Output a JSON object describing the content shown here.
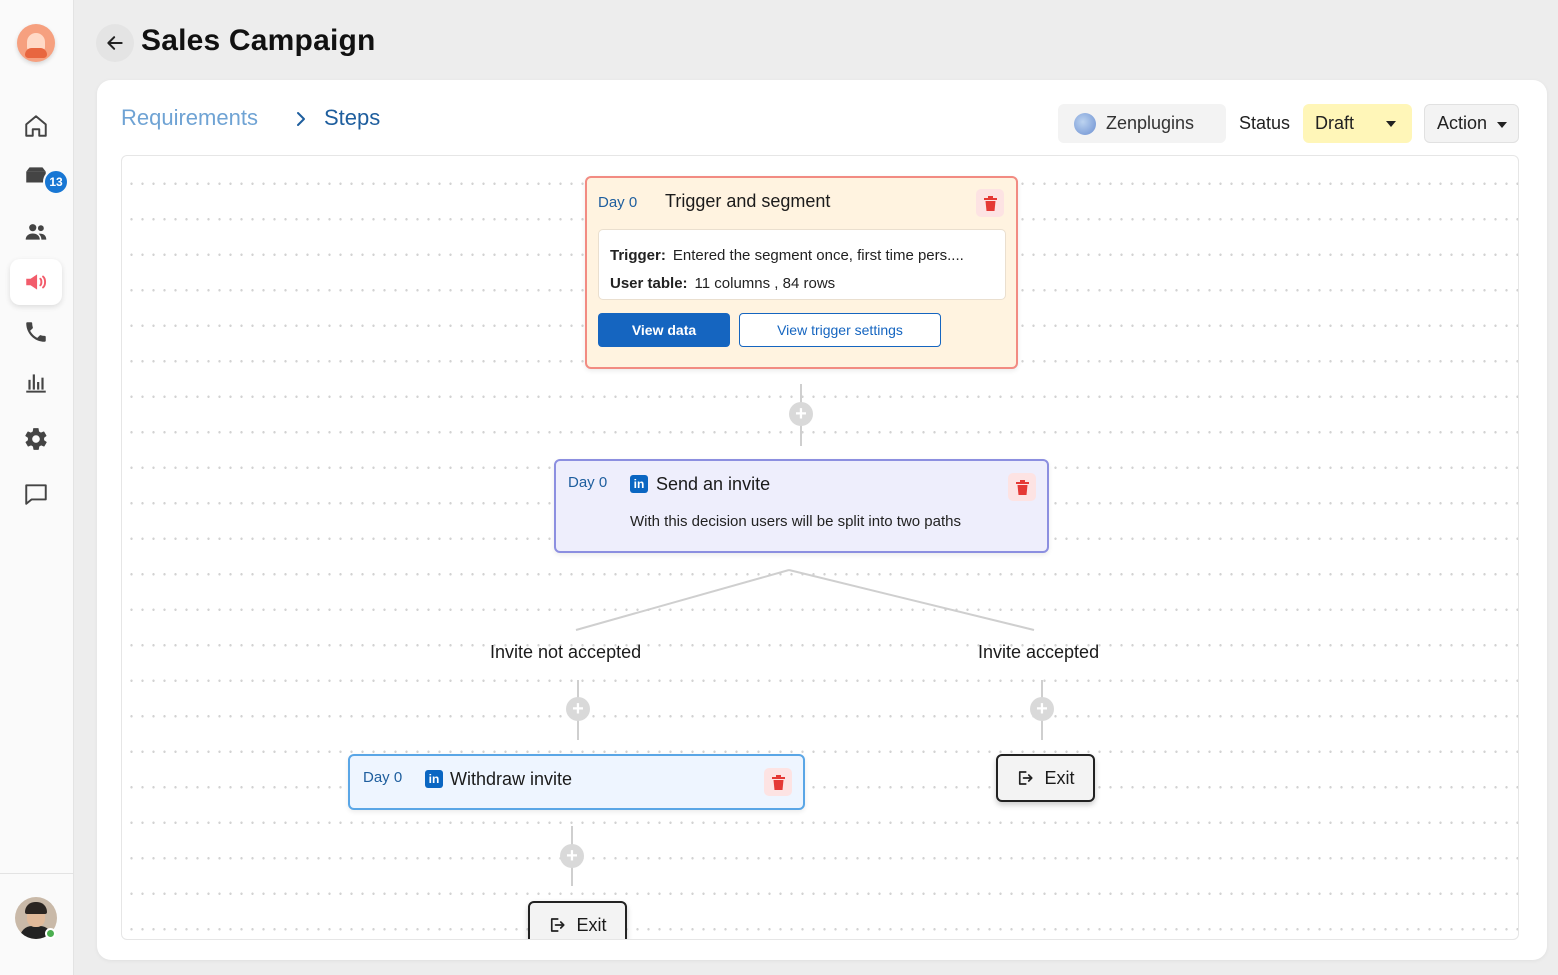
{
  "sidebar": {
    "logo_icon": "mascot-logo-icon",
    "nav": [
      {
        "name": "home",
        "icon": "home-icon"
      },
      {
        "name": "inbox",
        "icon": "inbox-icon",
        "badge": "13"
      },
      {
        "name": "contacts",
        "icon": "people-icon"
      },
      {
        "name": "campaigns",
        "icon": "megaphone-icon",
        "active": true
      },
      {
        "name": "calls",
        "icon": "phone-icon"
      },
      {
        "name": "analytics",
        "icon": "bar-chart-icon"
      },
      {
        "name": "settings",
        "icon": "gear-icon"
      },
      {
        "name": "messages",
        "icon": "chat-icon"
      }
    ],
    "user_status": "online"
  },
  "header": {
    "title": "Sales Campaign"
  },
  "breadcrumb": {
    "items": [
      "Requirements",
      "Steps"
    ]
  },
  "toolbar": {
    "integration": "Zenplugins",
    "status_label": "Status",
    "status_value": "Draft",
    "action_label": "Action"
  },
  "flow": {
    "trigger": {
      "day": "Day 0",
      "title": "Trigger and segment",
      "trigger_label": "Trigger:",
      "trigger_value": "Entered the segment once, first time pers....",
      "table_label": "User table:",
      "table_value": "11 columns , 84 rows",
      "view_data": "View data",
      "view_trigger": "View trigger settings"
    },
    "invite": {
      "day": "Day 0",
      "title": "Send an invite",
      "description": "With this decision users will be split into two paths"
    },
    "branches": {
      "left": "Invite not accepted",
      "right": "Invite accepted"
    },
    "withdraw": {
      "day": "Day 0",
      "title": "Withdraw invite"
    },
    "exit_label": "Exit"
  },
  "colors": {
    "accent": "#1565c0",
    "trigger_bg": "#fff3e0",
    "trigger_border": "#f28b82",
    "invite_bg": "#eeeefc",
    "invite_border": "#8c8fe0",
    "withdraw_bg": "#eef5ff",
    "withdraw_border": "#5aa6e6",
    "status_bg": "#fff6b8",
    "delete": "#e53935"
  }
}
